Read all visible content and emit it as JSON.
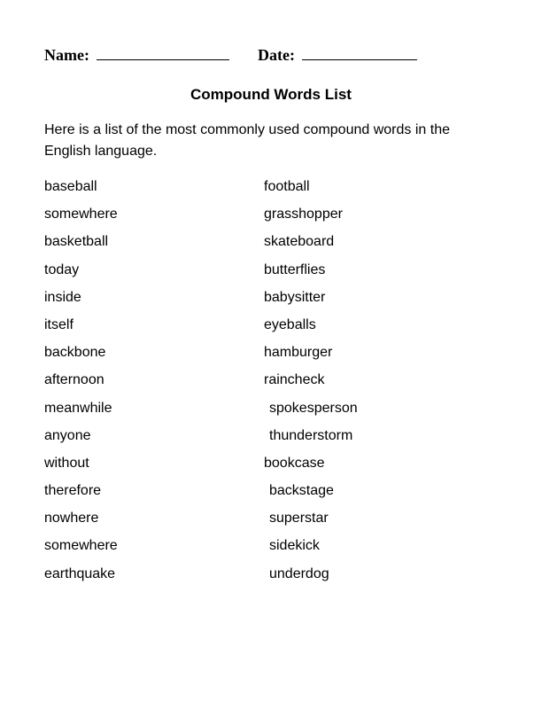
{
  "header": {
    "name_label": "Name:",
    "date_label": "Date:"
  },
  "title": "Compound Words List",
  "intro": "Here is a list of the most commonly used compound words in the English language.",
  "left_column": [
    "baseball",
    "somewhere",
    "basketball",
    "today",
    "inside",
    "itself",
    "backbone",
    "afternoon",
    "meanwhile",
    "anyone",
    "without",
    "therefore",
    "nowhere",
    "somewhere",
    "earthquake"
  ],
  "right_column": [
    {
      "text": "football",
      "nudge": false
    },
    {
      "text": "grasshopper",
      "nudge": false
    },
    {
      "text": "skateboard",
      "nudge": false
    },
    {
      "text": "butterflies",
      "nudge": false
    },
    {
      "text": "babysitter",
      "nudge": false
    },
    {
      "text": "eyeballs",
      "nudge": false
    },
    {
      "text": "hamburger",
      "nudge": false
    },
    {
      "text": "raincheck",
      "nudge": false
    },
    {
      "text": "spokesperson",
      "nudge": true
    },
    {
      "text": "thunderstorm",
      "nudge": true
    },
    {
      "text": "bookcase",
      "nudge": false
    },
    {
      "text": "backstage",
      "nudge": true
    },
    {
      "text": "superstar",
      "nudge": true
    },
    {
      "text": "sidekick",
      "nudge": true
    },
    {
      "text": "underdog",
      "nudge": true
    }
  ]
}
